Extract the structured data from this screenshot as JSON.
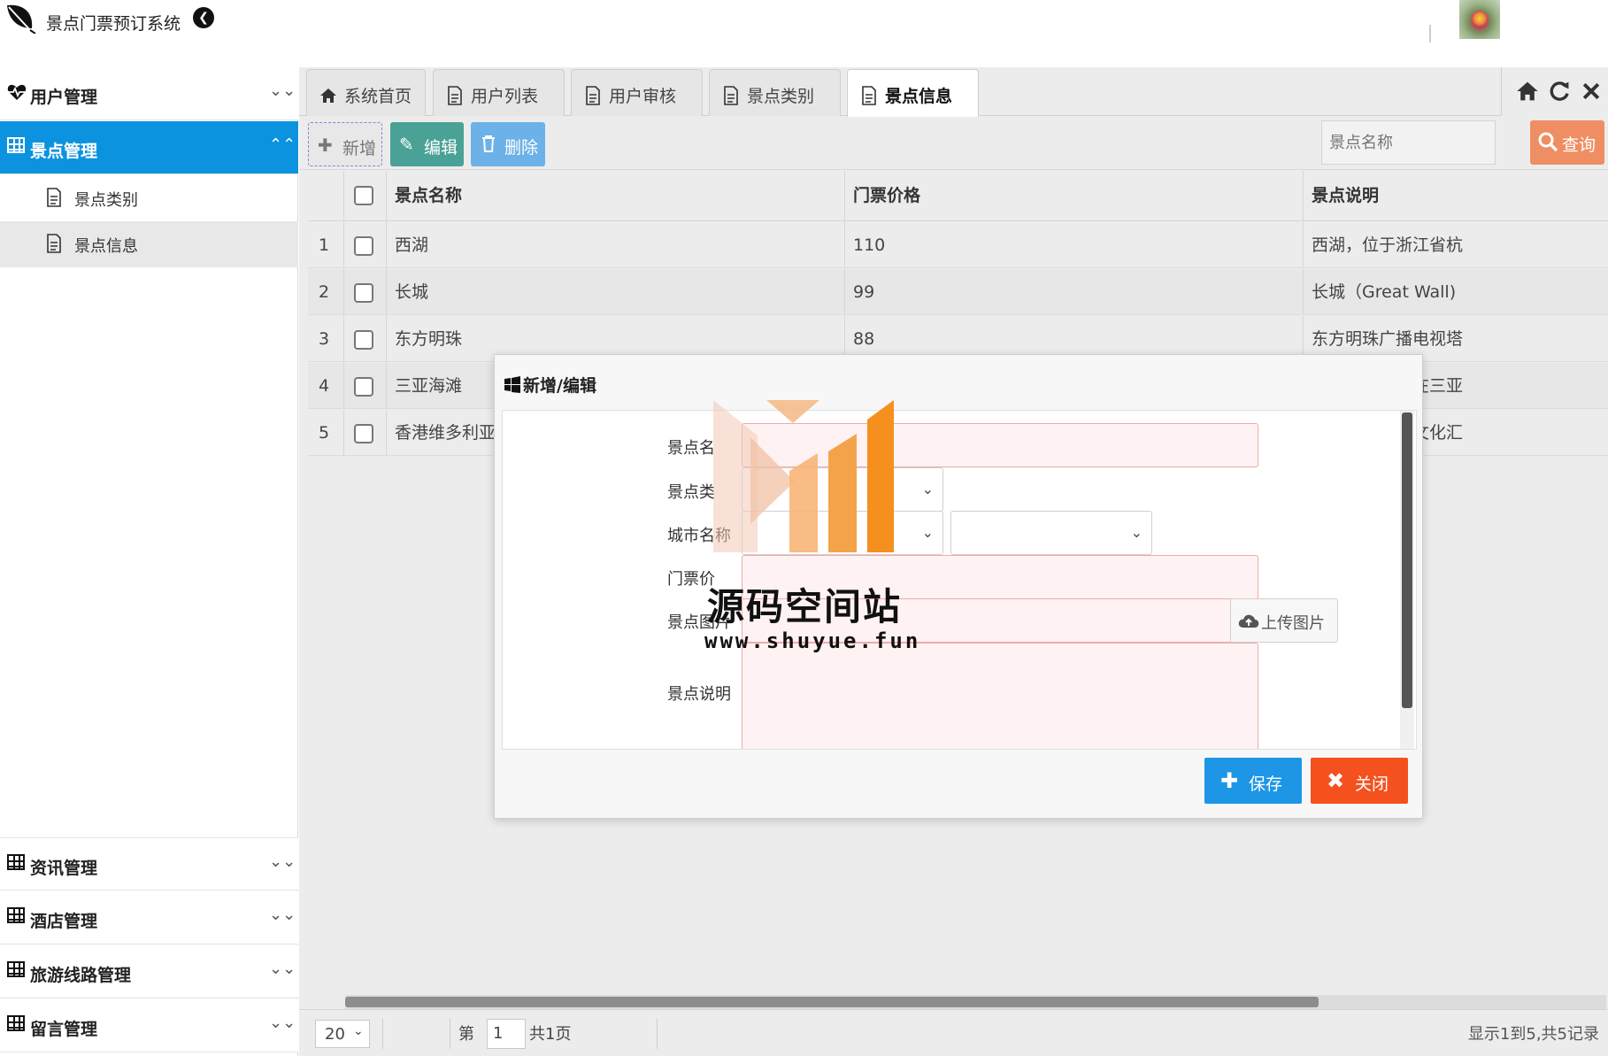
{
  "app": {
    "title": "景点门票预订系统"
  },
  "sidebar": {
    "groups": [
      {
        "label": "用户管理",
        "expanded": false,
        "icon": "heart-pulse-icon"
      },
      {
        "label": "景点管理",
        "expanded": true,
        "icon": "table-grid-icon",
        "items": [
          {
            "label": "景点类别",
            "selected": false
          },
          {
            "label": "景点信息",
            "selected": true
          }
        ]
      },
      {
        "label": "资讯管理",
        "expanded": false,
        "icon": "table-grid-icon"
      },
      {
        "label": "酒店管理",
        "expanded": false,
        "icon": "table-grid-icon"
      },
      {
        "label": "旅游线路管理",
        "expanded": false,
        "icon": "table-grid-icon"
      },
      {
        "label": "留言管理",
        "expanded": false,
        "icon": "table-grid-icon"
      }
    ]
  },
  "tabs": [
    {
      "label": "系统首页",
      "icon": "home-icon",
      "active": false
    },
    {
      "label": "用户列表",
      "icon": "document-icon",
      "active": false
    },
    {
      "label": "用户审核",
      "icon": "document-icon",
      "active": false
    },
    {
      "label": "景点类别",
      "icon": "document-icon",
      "active": false
    },
    {
      "label": "景点信息",
      "icon": "document-icon",
      "active": true
    }
  ],
  "tab_tools": [
    "home-icon",
    "refresh-icon",
    "close-icon"
  ],
  "toolbar": {
    "add_label": "新增",
    "edit_label": "编辑",
    "delete_label": "删除",
    "search_placeholder": "景点名称",
    "search_label": "查询"
  },
  "grid": {
    "columns": [
      "景点名称",
      "门票价格",
      "景点说明"
    ],
    "rows": [
      {
        "no": "1",
        "name": "西湖",
        "price": "110",
        "desc": "西湖，位于浙江省杭"
      },
      {
        "no": "2",
        "name": "长城",
        "price": "99",
        "desc": "长城（Great Wall)"
      },
      {
        "no": "3",
        "name": "东方明珠",
        "price": "88",
        "desc": "东方明珠广播电视塔"
      },
      {
        "no": "4",
        "name": "三亚海滩",
        "price": "",
        "desc": "蜈支洲岛坐落在三亚"
      },
      {
        "no": "5",
        "name": "香港维多利亚",
        "price": "",
        "desc": "香港作为中西文化汇"
      }
    ]
  },
  "pager": {
    "page_size": "20",
    "page_prefix": "第",
    "page_value": "1",
    "page_suffix": "共1页",
    "info": "显示1到5,共5记录"
  },
  "dialog": {
    "title": "新增/编辑",
    "fields": {
      "name_label": "景点名",
      "category_label": "景点类",
      "city_label": "城市名称",
      "price_label": "门票价",
      "image_label": "景点图片",
      "desc_label": "景点说明"
    },
    "upload_label": "上传图片",
    "save_label": "保存",
    "close_label": "关闭"
  },
  "watermark": {
    "text": "源码空间站",
    "url": "www.shuyue.fun"
  },
  "colors": {
    "accent": "#0b93e0",
    "edit": "#4aa196",
    "delete": "#6cb2e8",
    "search": "#ef8e63",
    "save": "#1e96e6",
    "close": "#f4511e",
    "watermark_orange": "#f5901e"
  }
}
